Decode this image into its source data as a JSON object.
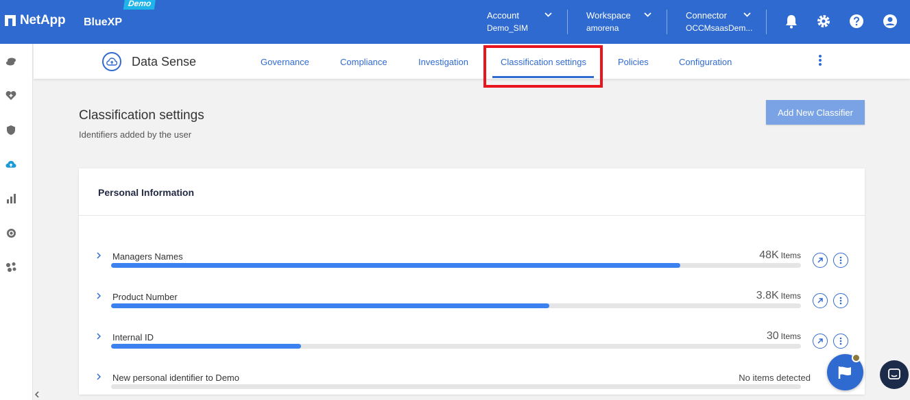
{
  "header": {
    "brand": "NetApp",
    "product": "BlueXP",
    "demo_badge": "Demo",
    "account": {
      "label": "Account",
      "value": "Demo_SIM"
    },
    "workspace": {
      "label": "Workspace",
      "value": "amorena"
    },
    "connector": {
      "label": "Connector",
      "value": "OCCMsaasDem..."
    },
    "icons": [
      "bell-icon",
      "gear-icon",
      "help-icon",
      "user-icon"
    ]
  },
  "rail": {
    "icons": [
      "storage-icon",
      "health-icon",
      "shield-icon",
      "data-sense-icon",
      "analytics-icon",
      "sync-icon",
      "nodes-icon"
    ]
  },
  "subnav": {
    "title": "Data Sense",
    "tabs": [
      {
        "label": "Governance"
      },
      {
        "label": "Compliance"
      },
      {
        "label": "Investigation"
      },
      {
        "label": "Classification settings",
        "active": true
      },
      {
        "label": "Policies"
      },
      {
        "label": "Configuration"
      }
    ]
  },
  "page": {
    "title": "Classification settings",
    "subtitle": "Identifiers added by the user",
    "add_button": "Add New Classifier"
  },
  "card": {
    "title": "Personal Information",
    "rows": [
      {
        "name": "Managers Names",
        "count": "48K",
        "unit": "Items",
        "fraction": 0.825
      },
      {
        "name": "Product Number",
        "count": "3.8K",
        "unit": "Items",
        "fraction": 0.635
      },
      {
        "name": "Internal ID",
        "count": "30",
        "unit": "Items",
        "fraction": 0.275
      },
      {
        "name": "New personal identifier to Demo",
        "none_text": "No items detected",
        "fraction": 0
      }
    ]
  },
  "colors": {
    "primary": "#2f6ad0",
    "highlight": "#e8141e",
    "bar": "#3b82f0"
  }
}
